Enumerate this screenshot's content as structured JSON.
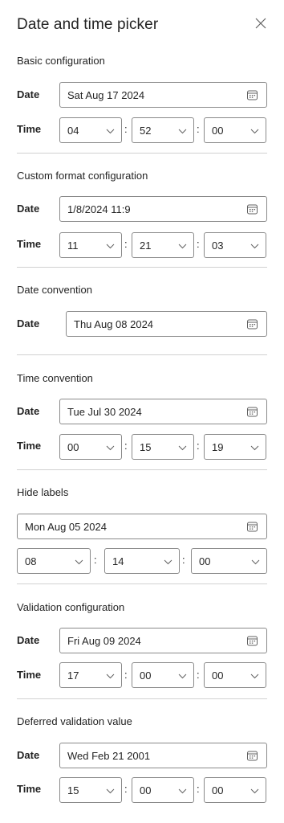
{
  "panel": {
    "title": "Date and time picker",
    "close_icon": "close-icon"
  },
  "labels": {
    "date": "Date",
    "time": "Time"
  },
  "sections": [
    {
      "title": "Basic configuration",
      "date": "Sat Aug 17 2024",
      "hour": "04",
      "minute": "52",
      "second": "00"
    },
    {
      "title": "Custom format configuration",
      "date": "1/8/2024 11:9",
      "hour": "11",
      "minute": "21",
      "second": "03"
    },
    {
      "title": "Date convention",
      "date": "Thu Aug 08 2024"
    },
    {
      "title": "Time convention",
      "date": "Tue Jul 30 2024",
      "hour": "00",
      "minute": "15",
      "second": "19"
    },
    {
      "title": "Hide labels",
      "date": "Mon Aug 05 2024",
      "hour": "08",
      "minute": "14",
      "second": "00"
    },
    {
      "title": "Validation configuration",
      "date": "Fri Aug 09 2024",
      "hour": "17",
      "minute": "00",
      "second": "00"
    },
    {
      "title": "Deferred validation value",
      "date": "Wed Feb 21 2001",
      "hour": "15",
      "minute": "00",
      "second": "00"
    }
  ],
  "separator": ":"
}
